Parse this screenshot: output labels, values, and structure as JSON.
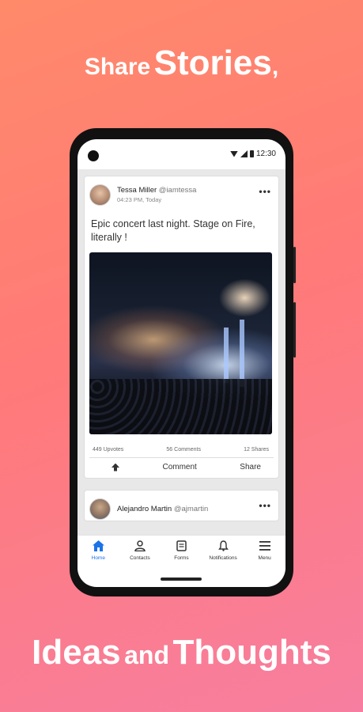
{
  "headline_top": {
    "small": "Share",
    "big": "Stories",
    "suffix": ","
  },
  "headline_bottom": {
    "big": "Ideas",
    "small": "and",
    "big2": "Thoughts"
  },
  "status_bar": {
    "time": "12:30"
  },
  "posts": [
    {
      "author": "Tessa Miller",
      "handle": "@iamtessa",
      "time": "04:23 PM, Today",
      "text": "Epic concert last night. Stage on Fire, literally !",
      "upvotes": "449 Upvotes",
      "comments": "56 Comments",
      "shares": "12 Shares",
      "comment_label": "Comment",
      "share_label": "Share",
      "more": "•••"
    },
    {
      "author": "Alejandro Martin",
      "handle": "@ajmartin",
      "more": "•••"
    }
  ],
  "nav": [
    {
      "label": "Home",
      "icon": "home-icon",
      "active": true
    },
    {
      "label": "Contacts",
      "icon": "person-icon"
    },
    {
      "label": "Forms",
      "icon": "clipboard-icon"
    },
    {
      "label": "Notifications",
      "icon": "bell-icon"
    },
    {
      "label": "Menu",
      "icon": "hamburger-icon"
    }
  ],
  "colors": {
    "accent": "#1a73e8",
    "bg_start": "#ff8a6a",
    "bg_end": "#f77ea0"
  }
}
